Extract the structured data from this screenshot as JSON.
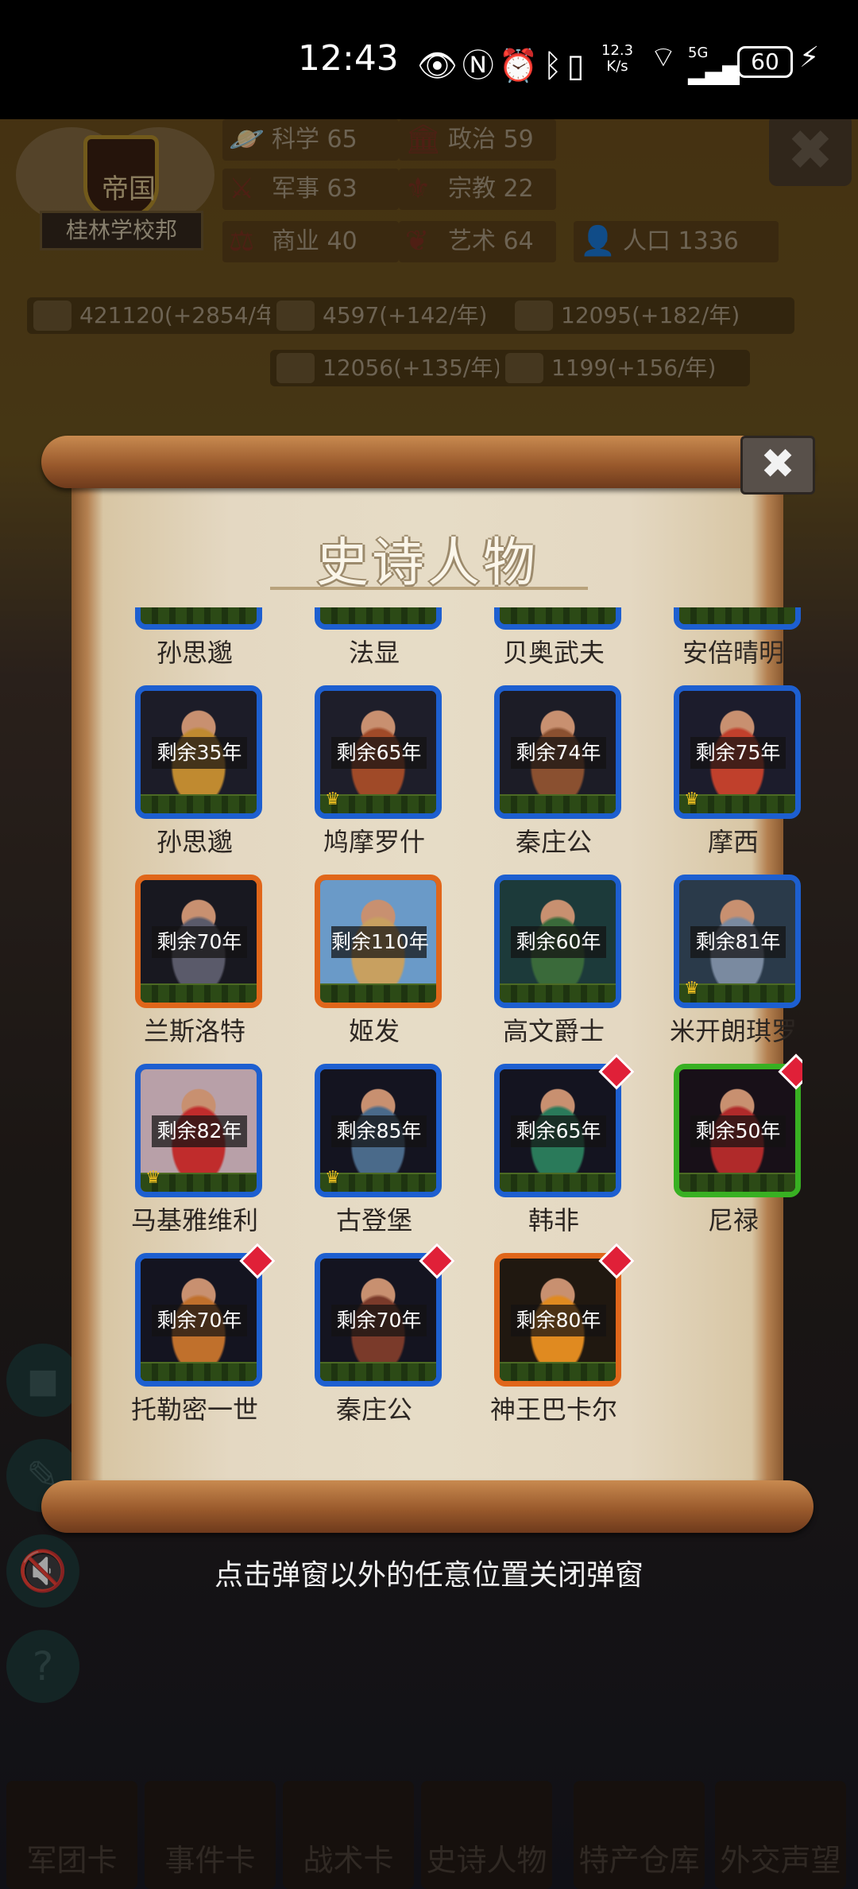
{
  "status": {
    "time": "12:43",
    "net_speed_top": "12.3",
    "net_speed_bottom": "K/s",
    "net_type": "5G",
    "battery": "60"
  },
  "header": {
    "empire_label": "帝国",
    "empire_name": "桂林学校邦",
    "stats": [
      {
        "label": "科学",
        "value": "65"
      },
      {
        "label": "政治",
        "value": "59"
      },
      {
        "label": "军事",
        "value": "63"
      },
      {
        "label": "宗教",
        "value": "22"
      },
      {
        "label": "商业",
        "value": "40"
      },
      {
        "label": "艺术",
        "value": "64"
      },
      {
        "label": "人口",
        "value": "1336"
      }
    ],
    "resources": [
      "421120(+2854/年",
      "4597(+142/年)",
      "12095(+182/年)",
      "12056(+135/年)",
      "1199(+156/年)"
    ]
  },
  "popup": {
    "title": "史诗人物",
    "close_symbol": "✖",
    "rows": [
      [
        {
          "name": "孙思邈",
          "remain": "",
          "frame": "blue",
          "crown": false,
          "badge": false,
          "colors": [
            "#3a3020",
            "#c89a3a"
          ]
        },
        {
          "name": "法显",
          "remain": "",
          "frame": "blue",
          "crown": false,
          "badge": false,
          "colors": [
            "#2a2030",
            "#7a4a30"
          ]
        },
        {
          "name": "贝奥武夫",
          "remain": "",
          "frame": "blue",
          "crown": false,
          "badge": false,
          "colors": [
            "#2a2a30",
            "#8a6a40"
          ]
        },
        {
          "name": "安倍晴明",
          "remain": "",
          "frame": "blue",
          "crown": false,
          "badge": false,
          "colors": [
            "#3a3020",
            "#d0a060"
          ]
        }
      ],
      [
        {
          "name": "孙思邈",
          "remain": "剩余35年",
          "frame": "blue",
          "crown": false,
          "badge": false,
          "colors": [
            "#1c1c28",
            "#c08a30"
          ]
        },
        {
          "name": "鸠摩罗什",
          "remain": "剩余65年",
          "frame": "blue",
          "crown": true,
          "badge": false,
          "colors": [
            "#1e1e2a",
            "#a04a28"
          ]
        },
        {
          "name": "秦庄公",
          "remain": "剩余74年",
          "frame": "blue",
          "crown": false,
          "badge": false,
          "colors": [
            "#1c1c26",
            "#8a5030"
          ]
        },
        {
          "name": "摩西",
          "remain": "剩余75年",
          "frame": "blue",
          "crown": true,
          "badge": false,
          "colors": [
            "#1c1c2c",
            "#c0402c"
          ]
        }
      ],
      [
        {
          "name": "兰斯洛特",
          "remain": "剩余70年",
          "frame": "orange",
          "crown": false,
          "badge": false,
          "colors": [
            "#181820",
            "#5a5a6a"
          ]
        },
        {
          "name": "姬发",
          "remain": "剩余110年",
          "frame": "orange",
          "crown": false,
          "badge": false,
          "colors": [
            "#6a9ac8",
            "#c8a060"
          ]
        },
        {
          "name": "高文爵士",
          "remain": "剩余60年",
          "frame": "blue",
          "crown": false,
          "badge": false,
          "colors": [
            "#1c3a3a",
            "#3a6a3a"
          ]
        },
        {
          "name": "米开朗琪罗",
          "remain": "剩余81年",
          "frame": "blue",
          "crown": true,
          "badge": false,
          "colors": [
            "#2a3a4a",
            "#7a8aa0"
          ]
        }
      ],
      [
        {
          "name": "马基雅维利",
          "remain": "剩余82年",
          "frame": "blue",
          "crown": true,
          "badge": false,
          "colors": [
            "#b8a0a8",
            "#c02c2c"
          ]
        },
        {
          "name": "古登堡",
          "remain": "剩余85年",
          "frame": "blue",
          "crown": true,
          "badge": false,
          "colors": [
            "#141420",
            "#4a6a8a"
          ]
        },
        {
          "name": "韩非",
          "remain": "剩余65年",
          "frame": "blue",
          "crown": false,
          "badge": true,
          "colors": [
            "#141420",
            "#2a7a5a"
          ]
        },
        {
          "name": "尼禄",
          "remain": "剩余50年",
          "frame": "green",
          "crown": false,
          "badge": true,
          "colors": [
            "#181018",
            "#b02a2a"
          ]
        }
      ],
      [
        {
          "name": "托勒密一世",
          "remain": "剩余70年",
          "frame": "blue",
          "crown": false,
          "badge": true,
          "colors": [
            "#141420",
            "#c0702c"
          ]
        },
        {
          "name": "秦庄公",
          "remain": "剩余70年",
          "frame": "blue",
          "crown": false,
          "badge": true,
          "colors": [
            "#141420",
            "#7a3a2a"
          ]
        },
        {
          "name": "神王巴卡尔",
          "remain": "剩余80年",
          "frame": "orange",
          "crown": false,
          "badge": true,
          "colors": [
            "#201810",
            "#e08a20"
          ]
        }
      ]
    ]
  },
  "hint": "点击弹窗以外的任意位置关闭弹窗",
  "nav": [
    "军团卡",
    "事件卡",
    "战术卡",
    "史诗人物",
    "特产仓库",
    "外交声望"
  ]
}
